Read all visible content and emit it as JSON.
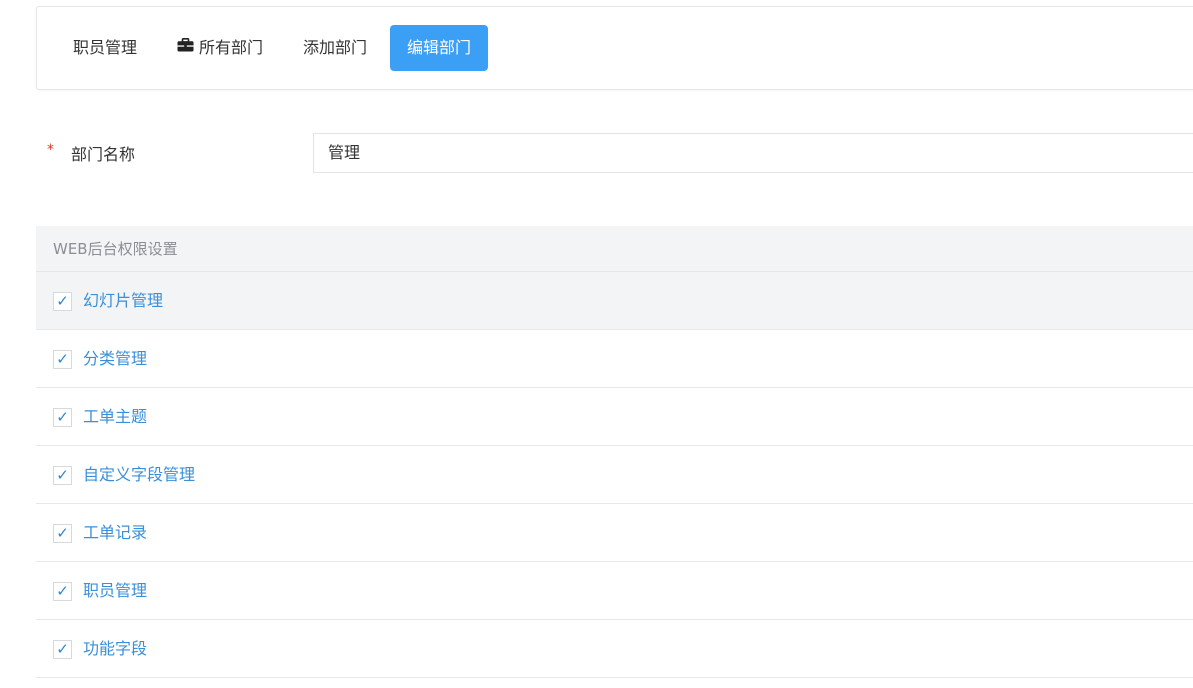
{
  "tabs": [
    {
      "label": "职员管理",
      "icon": null,
      "active": false
    },
    {
      "label": "所有部门",
      "icon": "briefcase-icon",
      "active": false
    },
    {
      "label": "添加部门",
      "icon": null,
      "active": false
    },
    {
      "label": "编辑部门",
      "icon": null,
      "active": true
    }
  ],
  "form": {
    "required_mark": "*",
    "department_label": "部门名称",
    "department_value": "管理"
  },
  "permissions": {
    "header": "WEB后台权限设置",
    "check_glyph": "✓",
    "items": [
      {
        "label": "幻灯片管理",
        "checked": true
      },
      {
        "label": "分类管理",
        "checked": true
      },
      {
        "label": "工单主题",
        "checked": true
      },
      {
        "label": "自定义字段管理",
        "checked": true
      },
      {
        "label": "工单记录",
        "checked": true
      },
      {
        "label": "职员管理",
        "checked": true
      },
      {
        "label": "功能字段",
        "checked": true
      }
    ]
  },
  "colors": {
    "accent": "#3b9ff5",
    "link": "#3a8fd8",
    "required": "#e0322a"
  }
}
